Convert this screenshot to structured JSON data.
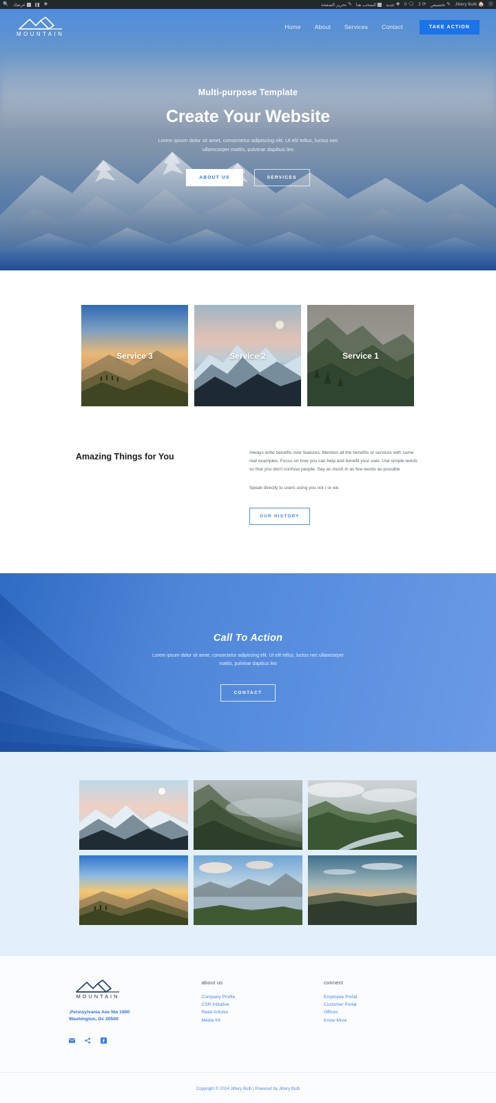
{
  "adminbar": {
    "left_items": [
      {
        "label": "",
        "icon": "search-icon"
      },
      {
        "label": "عرضك",
        "icon": "screen-icon"
      },
      {
        "label": "",
        "icon": "stats-icon"
      },
      {
        "label": "",
        "icon": "share-icon"
      }
    ],
    "right_items": [
      {
        "label": "",
        "icon": "wordpress-icon"
      },
      {
        "label": "Jittery Bulb",
        "icon": "home-icon"
      },
      {
        "label": "تخصيص",
        "icon": "pencil-icon"
      },
      {
        "label": "2",
        "icon": "updates-icon"
      },
      {
        "label": "0",
        "icon": "comments-icon"
      },
      {
        "label": "جديد",
        "icon": "plus-icon"
      },
      {
        "label": "السحب هنا",
        "icon": "page-icon"
      },
      {
        "label": "تحرير الصفحة",
        "icon": "edit-icon"
      }
    ]
  },
  "nav": {
    "cta_label": "TAKE ACTION",
    "links": [
      {
        "label": "Contact"
      },
      {
        "label": "Services"
      },
      {
        "label": "About"
      },
      {
        "label": "Home"
      }
    ],
    "logo_text": "MOUNTAIN"
  },
  "hero": {
    "eyebrow": "Multi-purpose Template",
    "title": "Create Your Website",
    "subtitle": "Lorem ipsum dolor sit amet, consectetur adipiscing elit. Ut elit tellus, luctus nec ullamcorper mattis, pulvinar dapibus leo",
    "primary_button": "ABOUT US",
    "secondary_button": "SERVICES"
  },
  "services": {
    "cards": [
      {
        "label": "Service 3",
        "image": "sunset-ridge-hikers"
      },
      {
        "label": "Service 2",
        "image": "snowy-peaks-dusk"
      },
      {
        "label": "Service 1",
        "image": "foggy-green-mountain"
      }
    ]
  },
  "benefits": {
    "heading": "Amazing Things for You",
    "paragraph1": "Always write benefits over features. Mention all the benefits or services with some real examples. Focus on how you can help and benefit your user. Use simple words so that you don't confuse people. Say as much in as few words as possible",
    "paragraph2": "Speak directly to users using you not I or we",
    "button": "OUR HISTORY"
  },
  "cta": {
    "title": "Call To Action",
    "subtitle": "Lorem ipsum dolor sit amet, consectetur adipiscing elit. Ut elit tellus, luctus nec ullamcorper mattis, pulvinar dapibus leo",
    "button": "CONTACT"
  },
  "gallery": {
    "items": [
      {
        "image": "snowcap-mountain-moon"
      },
      {
        "image": "cliff-forest-fog"
      },
      {
        "image": "river-valley-clouds"
      },
      {
        "image": "golden-sunrise-ridge"
      },
      {
        "image": "lake-mountain-clouds"
      },
      {
        "image": "hazy-sunset-horizon"
      }
    ]
  },
  "footer": {
    "connect": {
      "title": "connect",
      "links": [
        {
          "label": "Employee Portal"
        },
        {
          "label": "Customer Portal"
        },
        {
          "label": "Offices"
        },
        {
          "label": "Know More"
        }
      ]
    },
    "about": {
      "title": "about us",
      "links": [
        {
          "label": "Company Profile"
        },
        {
          "label": "CSR Initiative"
        },
        {
          "label": "Read Articles"
        },
        {
          "label": "Media Kit"
        }
      ]
    },
    "brand": {
      "logo_text": "MOUNTAIN",
      "address_line1": "Pennsylvania Ave Nw 1600,",
      "address_line2": "Washington, Dc 20500"
    },
    "social": [
      {
        "name": "email-icon"
      },
      {
        "name": "share-icon"
      },
      {
        "name": "facebook-icon"
      }
    ],
    "copyright": "Copyright © 2024 Jittery Bulb | Powered by Jittery Bulb"
  },
  "colors": {
    "accent": "#1a73e8",
    "link": "#4285f4",
    "adminbar_bg": "#23282d",
    "gallery_bg": "#e3f0fb"
  }
}
